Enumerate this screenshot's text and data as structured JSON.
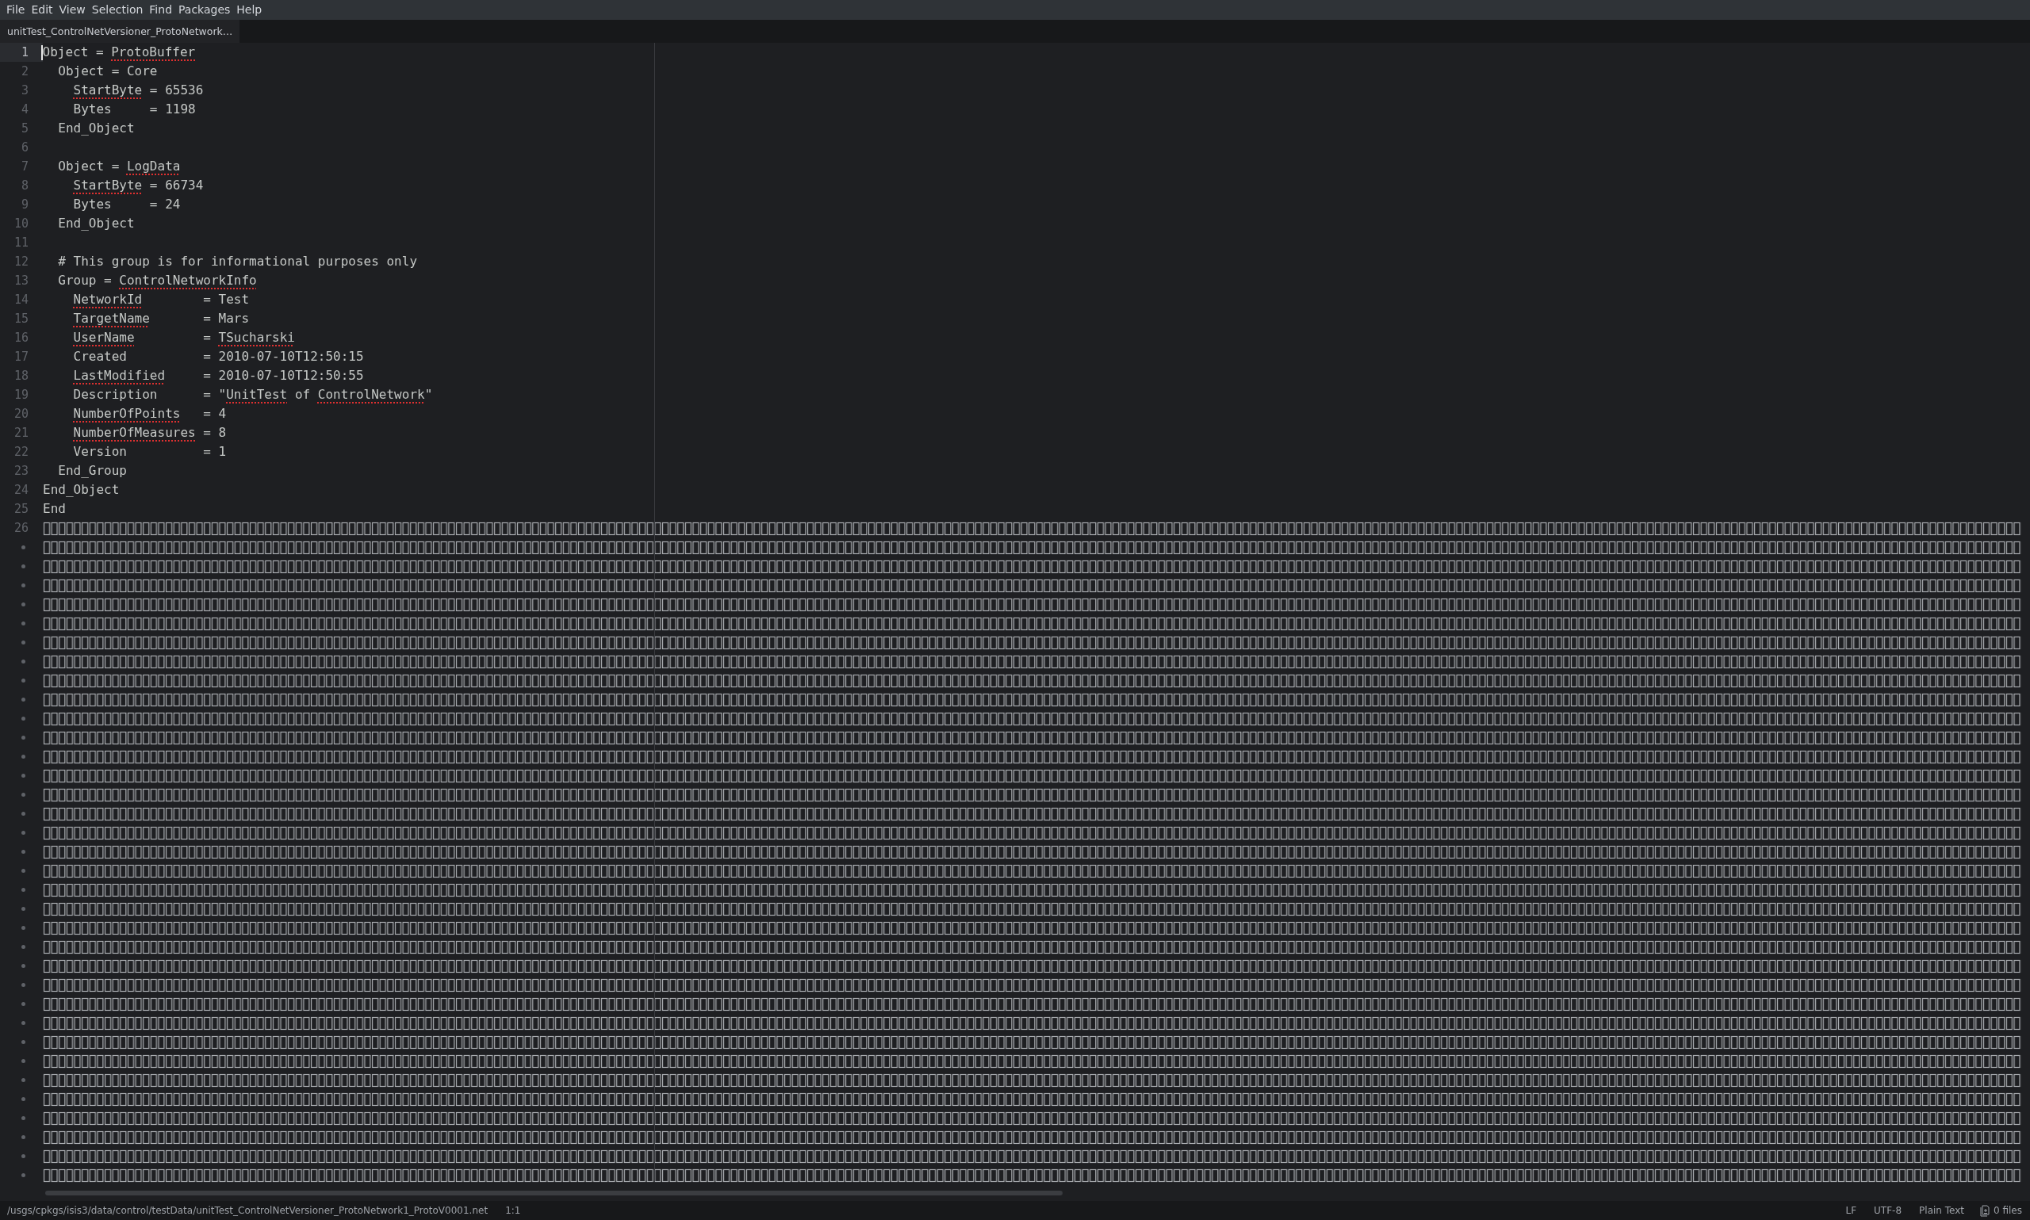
{
  "menu": [
    {
      "label": "File"
    },
    {
      "label": "Edit"
    },
    {
      "label": "View"
    },
    {
      "label": "Selection"
    },
    {
      "label": "Find"
    },
    {
      "label": "Packages"
    },
    {
      "label": "Help"
    }
  ],
  "tabs": [
    {
      "label": "unitTest_ControlNetVersioner_ProtoNetwork…",
      "selected": true
    }
  ],
  "editor": {
    "lines": [
      {
        "number": "1",
        "kind": "text",
        "current": true,
        "segments": [
          {
            "text": "Object = "
          },
          {
            "text": "ProtoBuffer",
            "misspelled": true
          }
        ]
      },
      {
        "number": "2",
        "kind": "text",
        "current": false,
        "segments": [
          {
            "text": "  Object = Core"
          }
        ]
      },
      {
        "number": "3",
        "kind": "text",
        "current": false,
        "segments": [
          {
            "text": "    StartByte",
            "misspelled": true
          },
          {
            "text": " = 65536"
          }
        ]
      },
      {
        "number": "4",
        "kind": "text",
        "current": false,
        "segments": [
          {
            "text": "    Bytes     = 1198"
          }
        ]
      },
      {
        "number": "5",
        "kind": "text",
        "current": false,
        "segments": [
          {
            "text": "  End_Object"
          }
        ]
      },
      {
        "number": "6",
        "kind": "text",
        "current": false
      },
      {
        "number": "7",
        "kind": "text",
        "current": false,
        "segments": [
          {
            "text": "  Object = "
          },
          {
            "text": "LogData",
            "misspelled": true
          }
        ]
      },
      {
        "number": "8",
        "kind": "text",
        "current": false,
        "segments": [
          {
            "text": "    StartByte",
            "misspelled": true
          },
          {
            "text": " = 66734"
          }
        ]
      },
      {
        "number": "9",
        "kind": "text",
        "current": false,
        "segments": [
          {
            "text": "    Bytes     = 24"
          }
        ]
      },
      {
        "number": "10",
        "kind": "text",
        "current": false,
        "segments": [
          {
            "text": "  End_Object"
          }
        ]
      },
      {
        "number": "11",
        "kind": "text",
        "current": false
      },
      {
        "number": "12",
        "kind": "text",
        "current": false,
        "segments": [
          {
            "text": "  # This group is for informational purposes only"
          }
        ]
      },
      {
        "number": "13",
        "kind": "text",
        "current": false,
        "segments": [
          {
            "text": "  Group = "
          },
          {
            "text": "ControlNetworkInfo",
            "misspelled": true
          }
        ]
      },
      {
        "number": "14",
        "kind": "text",
        "current": false,
        "segments": [
          {
            "text": "    NetworkId",
            "misspelled": true
          },
          {
            "text": "        = Test"
          }
        ]
      },
      {
        "number": "15",
        "kind": "text",
        "current": false,
        "segments": [
          {
            "text": "    TargetName",
            "misspelled": true
          },
          {
            "text": "       = Mars"
          }
        ]
      },
      {
        "number": "16",
        "kind": "text",
        "current": false,
        "segments": [
          {
            "text": "    UserName",
            "misspelled": true
          },
          {
            "text": "         = "
          },
          {
            "text": "TSucharski",
            "misspelled": true
          }
        ]
      },
      {
        "number": "17",
        "kind": "text",
        "current": false,
        "segments": [
          {
            "text": "    Created          = 2010-07-10T12:50:15"
          }
        ]
      },
      {
        "number": "18",
        "kind": "text",
        "current": false,
        "segments": [
          {
            "text": "    LastModified",
            "misspelled": true
          },
          {
            "text": "     = 2010-07-10T12:50:55"
          }
        ]
      },
      {
        "number": "19",
        "kind": "text",
        "current": false,
        "segments": [
          {
            "text": "    Description      = \""
          },
          {
            "text": "UnitTest",
            "misspelled": true
          },
          {
            "text": " of "
          },
          {
            "text": "ControlNetwork",
            "misspelled": true
          },
          {
            "text": "\""
          }
        ]
      },
      {
        "number": "20",
        "kind": "text",
        "current": false,
        "segments": [
          {
            "text": "    NumberOfPoints",
            "misspelled": true
          },
          {
            "text": "   = 4"
          }
        ]
      },
      {
        "number": "21",
        "kind": "text",
        "current": false,
        "segments": [
          {
            "text": "    NumberOfMeasures",
            "misspelled": true
          },
          {
            "text": " = 8"
          }
        ]
      },
      {
        "number": "22",
        "kind": "text",
        "current": false,
        "segments": [
          {
            "text": "    Version          = 1"
          }
        ]
      },
      {
        "number": "23",
        "kind": "text",
        "current": false,
        "segments": [
          {
            "text": "  End_Group"
          }
        ]
      },
      {
        "number": "24",
        "kind": "text",
        "current": false,
        "segments": [
          {
            "text": "End_Object"
          }
        ]
      },
      {
        "number": "25",
        "kind": "text",
        "current": false,
        "segments": [
          {
            "text": "End"
          }
        ]
      },
      {
        "number": "26",
        "kind": "binary",
        "current": false
      }
    ]
  },
  "status_bar": {
    "path": "/usgs/cpkgs/isis3/data/control/testData/unitTest_ControlNetVersioner_ProtoNetwork1_ProtoV0001.net",
    "cursor": "1:1",
    "line_ending": "LF",
    "encoding": "UTF-8",
    "grammar": "Plain Text",
    "files": "0 files"
  }
}
